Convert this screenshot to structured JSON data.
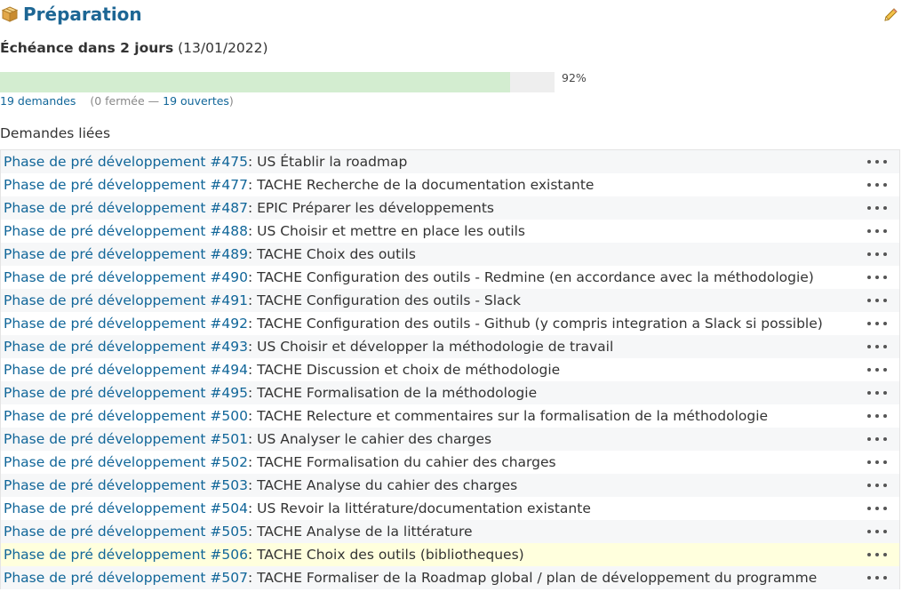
{
  "version": {
    "title": "Préparation",
    "icon": "package-icon",
    "edit_icon": "pencil-icon"
  },
  "due": {
    "prefix": "Échéance dans 2  jours",
    "date": "(13/01/2022)"
  },
  "progress": {
    "percent": 92,
    "label": "92%"
  },
  "counts": {
    "total": "19 demandes",
    "closed": "(0 fermée — ",
    "open": "19 ouvertes",
    "close_paren": ")"
  },
  "related": {
    "title": "Demandes liées",
    "more_icon": "ellipsis-icon",
    "issues": [
      {
        "link": "Phase de pré développement #475",
        "subject": ": US Établir la roadmap"
      },
      {
        "link": "Phase de pré développement #477",
        "subject": ": TACHE Recherche de la documentation existante"
      },
      {
        "link": "Phase de pré développement #487",
        "subject": ": EPIC Préparer les développements"
      },
      {
        "link": "Phase de pré développement #488",
        "subject": ": US Choisir et mettre en place les outils"
      },
      {
        "link": "Phase de pré développement #489",
        "subject": ": TACHE Choix des outils"
      },
      {
        "link": "Phase de pré développement #490",
        "subject": ": TACHE Configuration des outils - Redmine (en accordance avec la méthodologie)"
      },
      {
        "link": "Phase de pré développement #491",
        "subject": ": TACHE Configuration des outils - Slack"
      },
      {
        "link": "Phase de pré développement #492",
        "subject": ": TACHE Configuration des outils - Github (y compris integration a Slack si possible)"
      },
      {
        "link": "Phase de pré développement #493",
        "subject": ": US Choisir et développer la méthodologie de travail"
      },
      {
        "link": "Phase de pré développement #494",
        "subject": ": TACHE Discussion et choix de méthodologie"
      },
      {
        "link": "Phase de pré développement #495",
        "subject": ": TACHE Formalisation de la méthodologie"
      },
      {
        "link": "Phase de pré développement #500",
        "subject": ": TACHE Relecture et commentaires sur la formalisation de la méthodologie"
      },
      {
        "link": "Phase de pré développement #501",
        "subject": ": US Analyser le cahier des charges"
      },
      {
        "link": "Phase de pré développement #502",
        "subject": ": TACHE Formalisation du cahier des charges"
      },
      {
        "link": "Phase de pré développement #503",
        "subject": ": TACHE Analyse du cahier des charges"
      },
      {
        "link": "Phase de pré développement #504",
        "subject": ": US Revoir la littérature/documentation existante"
      },
      {
        "link": "Phase de pré développement #505",
        "subject": ": TACHE Analyse de la littérature"
      },
      {
        "link": "Phase de pré développement #506",
        "subject": ": TACHE Choix des outils (bibliotheques)",
        "highlighted": true
      },
      {
        "link": "Phase de pré développement #507",
        "subject": ": TACHE Formaliser de la Roadmap global / plan de développement du programme"
      }
    ]
  }
}
